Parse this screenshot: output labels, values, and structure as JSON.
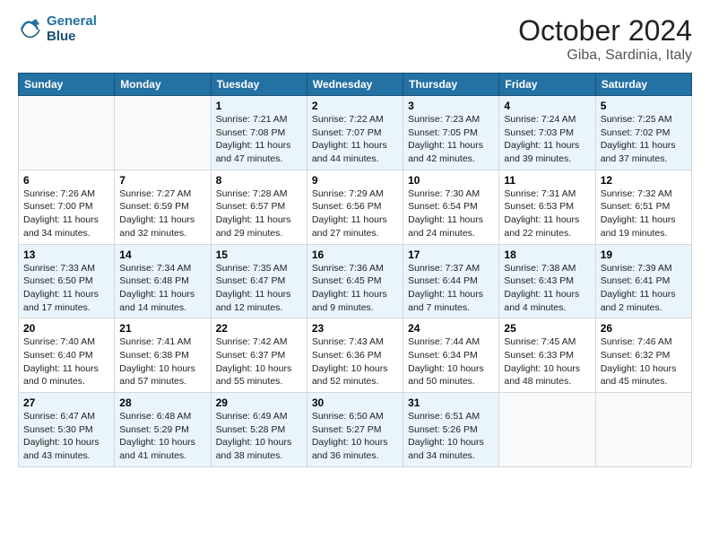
{
  "header": {
    "logo_line1": "General",
    "logo_line2": "Blue",
    "month": "October 2024",
    "location": "Giba, Sardinia, Italy"
  },
  "days_of_week": [
    "Sunday",
    "Monday",
    "Tuesday",
    "Wednesday",
    "Thursday",
    "Friday",
    "Saturday"
  ],
  "weeks": [
    [
      {
        "day": "",
        "info": ""
      },
      {
        "day": "",
        "info": ""
      },
      {
        "day": "1",
        "sunrise": "7:21 AM",
        "sunset": "7:08 PM",
        "daylight": "11 hours and 47 minutes."
      },
      {
        "day": "2",
        "sunrise": "7:22 AM",
        "sunset": "7:07 PM",
        "daylight": "11 hours and 44 minutes."
      },
      {
        "day": "3",
        "sunrise": "7:23 AM",
        "sunset": "7:05 PM",
        "daylight": "11 hours and 42 minutes."
      },
      {
        "day": "4",
        "sunrise": "7:24 AM",
        "sunset": "7:03 PM",
        "daylight": "11 hours and 39 minutes."
      },
      {
        "day": "5",
        "sunrise": "7:25 AM",
        "sunset": "7:02 PM",
        "daylight": "11 hours and 37 minutes."
      }
    ],
    [
      {
        "day": "6",
        "sunrise": "7:26 AM",
        "sunset": "7:00 PM",
        "daylight": "11 hours and 34 minutes."
      },
      {
        "day": "7",
        "sunrise": "7:27 AM",
        "sunset": "6:59 PM",
        "daylight": "11 hours and 32 minutes."
      },
      {
        "day": "8",
        "sunrise": "7:28 AM",
        "sunset": "6:57 PM",
        "daylight": "11 hours and 29 minutes."
      },
      {
        "day": "9",
        "sunrise": "7:29 AM",
        "sunset": "6:56 PM",
        "daylight": "11 hours and 27 minutes."
      },
      {
        "day": "10",
        "sunrise": "7:30 AM",
        "sunset": "6:54 PM",
        "daylight": "11 hours and 24 minutes."
      },
      {
        "day": "11",
        "sunrise": "7:31 AM",
        "sunset": "6:53 PM",
        "daylight": "11 hours and 22 minutes."
      },
      {
        "day": "12",
        "sunrise": "7:32 AM",
        "sunset": "6:51 PM",
        "daylight": "11 hours and 19 minutes."
      }
    ],
    [
      {
        "day": "13",
        "sunrise": "7:33 AM",
        "sunset": "6:50 PM",
        "daylight": "11 hours and 17 minutes."
      },
      {
        "day": "14",
        "sunrise": "7:34 AM",
        "sunset": "6:48 PM",
        "daylight": "11 hours and 14 minutes."
      },
      {
        "day": "15",
        "sunrise": "7:35 AM",
        "sunset": "6:47 PM",
        "daylight": "11 hours and 12 minutes."
      },
      {
        "day": "16",
        "sunrise": "7:36 AM",
        "sunset": "6:45 PM",
        "daylight": "11 hours and 9 minutes."
      },
      {
        "day": "17",
        "sunrise": "7:37 AM",
        "sunset": "6:44 PM",
        "daylight": "11 hours and 7 minutes."
      },
      {
        "day": "18",
        "sunrise": "7:38 AM",
        "sunset": "6:43 PM",
        "daylight": "11 hours and 4 minutes."
      },
      {
        "day": "19",
        "sunrise": "7:39 AM",
        "sunset": "6:41 PM",
        "daylight": "11 hours and 2 minutes."
      }
    ],
    [
      {
        "day": "20",
        "sunrise": "7:40 AM",
        "sunset": "6:40 PM",
        "daylight": "11 hours and 0 minutes."
      },
      {
        "day": "21",
        "sunrise": "7:41 AM",
        "sunset": "6:38 PM",
        "daylight": "10 hours and 57 minutes."
      },
      {
        "day": "22",
        "sunrise": "7:42 AM",
        "sunset": "6:37 PM",
        "daylight": "10 hours and 55 minutes."
      },
      {
        "day": "23",
        "sunrise": "7:43 AM",
        "sunset": "6:36 PM",
        "daylight": "10 hours and 52 minutes."
      },
      {
        "day": "24",
        "sunrise": "7:44 AM",
        "sunset": "6:34 PM",
        "daylight": "10 hours and 50 minutes."
      },
      {
        "day": "25",
        "sunrise": "7:45 AM",
        "sunset": "6:33 PM",
        "daylight": "10 hours and 48 minutes."
      },
      {
        "day": "26",
        "sunrise": "7:46 AM",
        "sunset": "6:32 PM",
        "daylight": "10 hours and 45 minutes."
      }
    ],
    [
      {
        "day": "27",
        "sunrise": "6:47 AM",
        "sunset": "5:30 PM",
        "daylight": "10 hours and 43 minutes."
      },
      {
        "day": "28",
        "sunrise": "6:48 AM",
        "sunset": "5:29 PM",
        "daylight": "10 hours and 41 minutes."
      },
      {
        "day": "29",
        "sunrise": "6:49 AM",
        "sunset": "5:28 PM",
        "daylight": "10 hours and 38 minutes."
      },
      {
        "day": "30",
        "sunrise": "6:50 AM",
        "sunset": "5:27 PM",
        "daylight": "10 hours and 36 minutes."
      },
      {
        "day": "31",
        "sunrise": "6:51 AM",
        "sunset": "5:26 PM",
        "daylight": "10 hours and 34 minutes."
      },
      {
        "day": "",
        "info": ""
      },
      {
        "day": "",
        "info": ""
      }
    ]
  ],
  "labels": {
    "sunrise": "Sunrise:",
    "sunset": "Sunset:",
    "daylight": "Daylight:"
  }
}
